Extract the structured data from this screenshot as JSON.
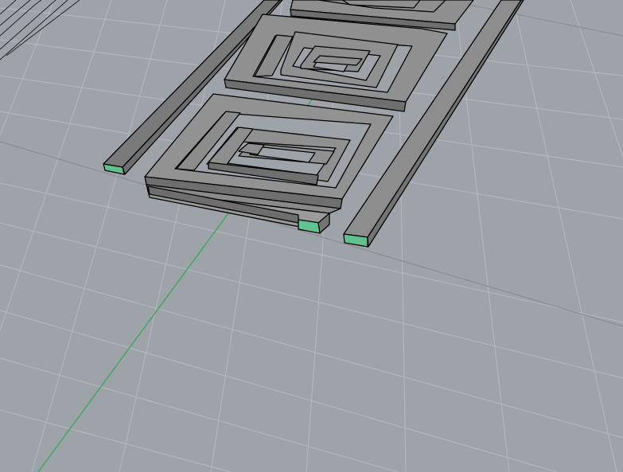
{
  "viewport": {
    "projection": "perspective",
    "background_color": "#9ea3aa",
    "grid": {
      "visible": true,
      "minor_line_color": "#b4b9bf",
      "major_line_color": "#8a8d93",
      "y_axis_color": "#3fa85a"
    },
    "object": {
      "name": "greek-key-border",
      "face_color": "#8c8c8c",
      "edge_color": "#000000",
      "selected_face_color": "#5fc28f"
    }
  }
}
